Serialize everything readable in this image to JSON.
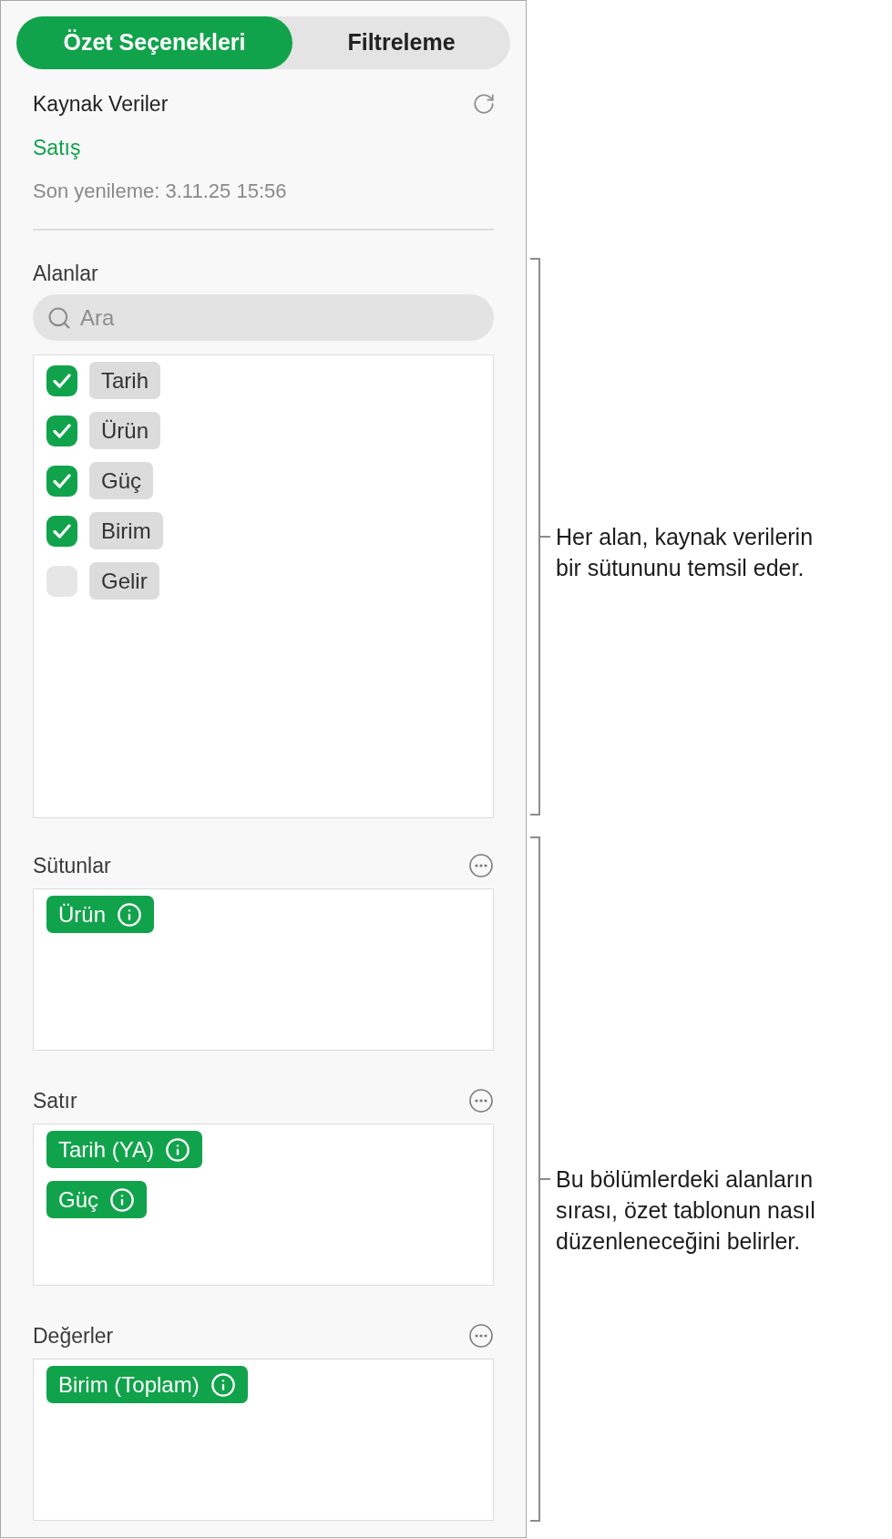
{
  "tabs": [
    {
      "label": "Özet Seçenekleri",
      "selected": true
    },
    {
      "label": "Filtreleme",
      "selected": false
    }
  ],
  "source": {
    "title": "Kaynak Veriler",
    "name": "Satış",
    "last_refresh": "Son yenileme: 3.11.25 15:56"
  },
  "fields": {
    "title": "Alanlar",
    "search": {
      "placeholder": "Ara"
    },
    "items": [
      {
        "label": "Tarih",
        "checked": true
      },
      {
        "label": "Ürün",
        "checked": true
      },
      {
        "label": "Güç",
        "checked": true
      },
      {
        "label": "Birim",
        "checked": true
      },
      {
        "label": "Gelir",
        "checked": false
      }
    ]
  },
  "sections": [
    {
      "title": "Sütunlar",
      "chips": [
        "Ürün"
      ]
    },
    {
      "title": "Satır",
      "chips": [
        "Tarih (YA)",
        "Güç"
      ]
    },
    {
      "title": "Değerler",
      "chips": [
        "Birim (Toplam)"
      ]
    }
  ],
  "callouts": [
    {
      "text": "Her alan, kaynak verilerin bir sütununu temsil eder."
    },
    {
      "text": "Bu bölümlerdeki alanların sırası, özet tablonun nasıl düzenleneceğini belirler."
    }
  ]
}
